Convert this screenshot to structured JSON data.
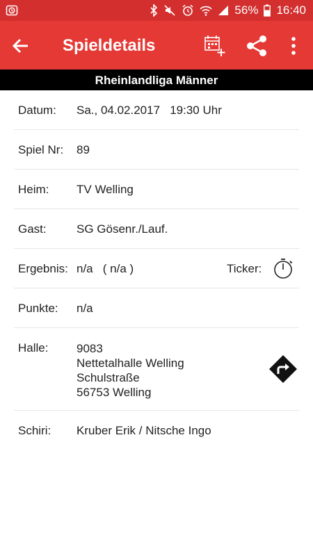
{
  "status_bar": {
    "battery": "56%",
    "time": "16:40",
    "icons": [
      "alarm-icon",
      "bluetooth-icon",
      "mute-icon",
      "alarm-clock-icon",
      "wifi-icon",
      "signal-icon",
      "battery-icon"
    ]
  },
  "app_bar": {
    "title": "Spieldetails",
    "icons": [
      "back-arrow-icon",
      "add-calendar-icon",
      "share-icon",
      "more-vert-icon"
    ]
  },
  "league": "Rheinlandliga Männer",
  "details": {
    "datum_label": "Datum:",
    "datum_value": "Sa., 04.02.2017   19:30 Uhr",
    "spielnr_label": "Spiel Nr:",
    "spielnr_value": "89",
    "heim_label": "Heim:",
    "heim_value": "TV Welling",
    "gast_label": "Gast:",
    "gast_value": "SG Gösenr./Lauf.",
    "ergebnis_label": "Ergebnis:",
    "ergebnis_value": "n/a   ( n/a )",
    "ticker_label": "Ticker:",
    "punkte_label": "Punkte:",
    "punkte_value": "n/a",
    "halle_label": "Halle:",
    "halle_lines": [
      "9083",
      "Nettetalhalle Welling",
      "Schulstraße",
      "56753 Welling"
    ],
    "schiri_label": "Schiri:",
    "schiri_value": "Kruber Erik / Nitsche Ingo"
  },
  "colors": {
    "status_bar": "#d32f2f",
    "app_bar": "#e53935",
    "league_bar": "#000000"
  }
}
